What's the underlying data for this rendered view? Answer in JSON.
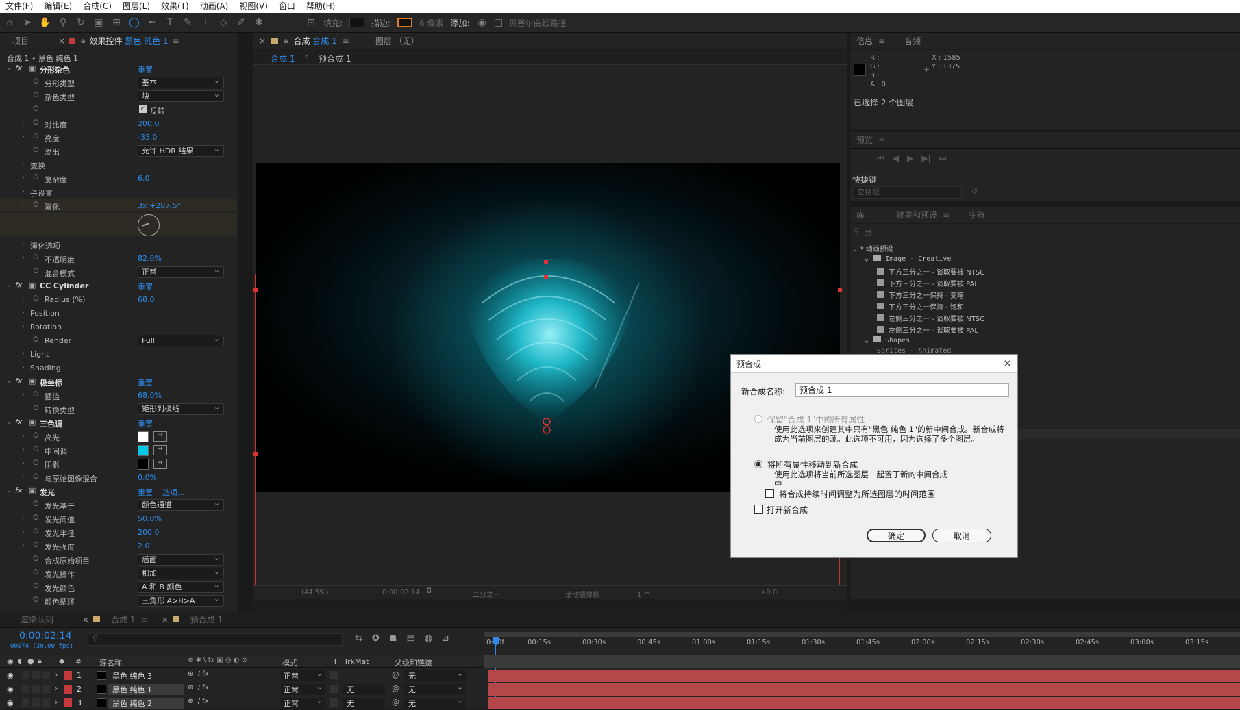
{
  "menu": [
    "文件(F)",
    "编辑(E)",
    "合成(C)",
    "图层(L)",
    "效果(T)",
    "动画(A)",
    "视图(V)",
    "窗口",
    "帮助(H)"
  ],
  "toolbar": {
    "fill": "填充:",
    "stroke": "描边:",
    "stroke_px": "6 像素",
    "add": "添加:",
    "bezier": "贝塞尔曲线路径"
  },
  "left_panel": {
    "tab_project": "项目",
    "tab_effects_prefix": "效果控件",
    "tab_effects_layer": "黑色 纯色 1",
    "breadcrumb": "合成 1 • 黑色 纯色 1",
    "rows": [
      {
        "kind": "fx",
        "label": "分形杂色",
        "reset": "重置"
      },
      {
        "kind": "sel",
        "label": "分形类型",
        "value": "基本"
      },
      {
        "kind": "sel",
        "label": "杂色类型",
        "value": "块"
      },
      {
        "kind": "check",
        "label": "",
        "value": "反转"
      },
      {
        "kind": "val",
        "label": "对比度",
        "value": "200.0"
      },
      {
        "kind": "val",
        "label": "亮度",
        "value": "-33.0"
      },
      {
        "kind": "sel",
        "label": "溢出",
        "value": "允许 HDR 结果"
      },
      {
        "kind": "grp",
        "label": "变换"
      },
      {
        "kind": "val",
        "label": "复杂度",
        "value": "6.0"
      },
      {
        "kind": "grp",
        "label": "子设置"
      },
      {
        "kind": "val",
        "label": "演化",
        "value": "3x +287.5°"
      },
      {
        "kind": "dial"
      },
      {
        "kind": "grp",
        "label": "演化选项"
      },
      {
        "kind": "val",
        "label": "不透明度",
        "value": "82.0%"
      },
      {
        "kind": "sel",
        "label": "混合模式",
        "value": "正常"
      },
      {
        "kind": "fx",
        "label": "CC Cylinder",
        "reset": "重置"
      },
      {
        "kind": "val",
        "label": "Radius (%)",
        "value": "68.0"
      },
      {
        "kind": "grp",
        "label": "Position"
      },
      {
        "kind": "grp",
        "label": "Rotation"
      },
      {
        "kind": "sel",
        "label": "Render",
        "value": "Full"
      },
      {
        "kind": "grp",
        "label": "Light"
      },
      {
        "kind": "grp",
        "label": "Shading"
      },
      {
        "kind": "fx",
        "label": "极坐标",
        "reset": "重置"
      },
      {
        "kind": "val",
        "label": "插值",
        "value": "68.0%"
      },
      {
        "kind": "sel",
        "label": "转换类型",
        "value": "矩形到极线"
      },
      {
        "kind": "fx",
        "label": "三色调",
        "reset": "重置"
      },
      {
        "kind": "swatch",
        "label": "高光",
        "color": "#ffffff"
      },
      {
        "kind": "swatch",
        "label": "中间调",
        "color": "#00c8e6"
      },
      {
        "kind": "swatch",
        "label": "阴影",
        "color": "#000000"
      },
      {
        "kind": "val",
        "label": "与原始图像混合",
        "value": "0.0%"
      },
      {
        "kind": "fx",
        "label": "发光",
        "reset": "重置",
        "extra": "选项..."
      },
      {
        "kind": "sel",
        "label": "发光基于",
        "value": "颜色通道"
      },
      {
        "kind": "val",
        "label": "发光阈值",
        "value": "50.0%"
      },
      {
        "kind": "val",
        "label": "发光半径",
        "value": "200.0"
      },
      {
        "kind": "val",
        "label": "发光强度",
        "value": "2.0"
      },
      {
        "kind": "sel",
        "label": "合成原始项目",
        "value": "后面"
      },
      {
        "kind": "sel",
        "label": "发光操作",
        "value": "相加"
      },
      {
        "kind": "sel",
        "label": "发光颜色",
        "value": "A 和 B 颜色"
      },
      {
        "kind": "sel",
        "label": "颜色循环",
        "value": "三角形 A>B>A"
      }
    ]
  },
  "comp_panel": {
    "tab_comp_prefix": "合成",
    "tab_comp_name": "合成 1",
    "tab_layer": "图层 （无）",
    "crumb1": "合成 1",
    "crumb2": "预合成 1",
    "footer": {
      "zoom": "(44.5%)",
      "time": "0:00:02:14",
      "quality": "二分之一",
      "camera": "活动摄像机",
      "views": "1 个...",
      "exposure": "+0.0"
    }
  },
  "info_panel": {
    "tab_info": "信息",
    "tab_audio": "音频",
    "r": "R :",
    "g": "G :",
    "b": "B :",
    "a": "A : 0",
    "x": "X : 1585",
    "y": "Y : 1375",
    "status": "已选择 2 个图层"
  },
  "preview_panel": {
    "title": "预览",
    "shortcut_label": "快捷键",
    "shortcut_value": "空格键"
  },
  "effects_panel": {
    "tab_lib": "库",
    "tab_effects": "效果和预设",
    "tab_char": "字符",
    "search": "分",
    "root": "* 动画预设",
    "folder1": "Image - Creative",
    "items": [
      "下方三分之一 - 谈取要被 NTSC",
      "下方三分之一 - 谈取要被 PAL",
      "下方三分之一保持 - 变暗",
      "下方三分之一保持 - 饱和",
      "左侧三分之一 - 谈取要被 NTSC",
      "左侧三分之一 - 谈取要被 PAL"
    ],
    "folder2": "Shapes",
    "folder3": "Sprites - Animated"
  },
  "dialog": {
    "title": "预合成",
    "name_label": "新合成名称:",
    "name_value": "预合成 1",
    "opt1_title": "保留\"合成 1\"中的所有属性",
    "opt1_desc": "使用此选项来创建其中只有\"黑色 纯色 1\"的新中间合成。新合成将成为当前图层的源。此选项不可用，因为选择了多个图层。",
    "opt2_title": "将所有属性移动到新合成",
    "opt2_desc": "使用此选项将当前所选图层一起置于新的中间合成中。",
    "cb1": "将合成持续时间调整为所选图层的时间范围",
    "cb2": "打开新合成",
    "ok": "确定",
    "cancel": "取消"
  },
  "timeline": {
    "tab_render": "渲染队列",
    "tab_comp1": "合成 1",
    "tab_precomp": "预合成 1",
    "timecode": "0:00:02:14",
    "frames": "00074 (30.00 fps)",
    "cols": {
      "num": "#",
      "source": "源名称",
      "mode": "模式",
      "t": "T",
      "trkmat": "TrkMat",
      "parent": "父级和链接"
    },
    "ticks": [
      "0:00f",
      "00:15s",
      "00:30s",
      "00:45s",
      "01:00s",
      "01:15s",
      "01:30s",
      "01:45s",
      "02:00s",
      "02:15s",
      "02:30s",
      "02:45s",
      "03:00s",
      "03:15s"
    ],
    "layers": [
      {
        "num": "1",
        "name": "黑色 纯色 3",
        "mode": "正常",
        "trk": "",
        "parent": "无"
      },
      {
        "num": "2",
        "name": "黑色 纯色 1",
        "mode": "正常",
        "trk": "无",
        "parent": "无"
      },
      {
        "num": "3",
        "name": "黑色 纯色 2",
        "mode": "正常",
        "trk": "无",
        "parent": "无"
      }
    ]
  },
  "colors": {
    "accent": "#2d8ceb",
    "layer_bar": "#b5474b",
    "label_red": "#c4393c"
  }
}
